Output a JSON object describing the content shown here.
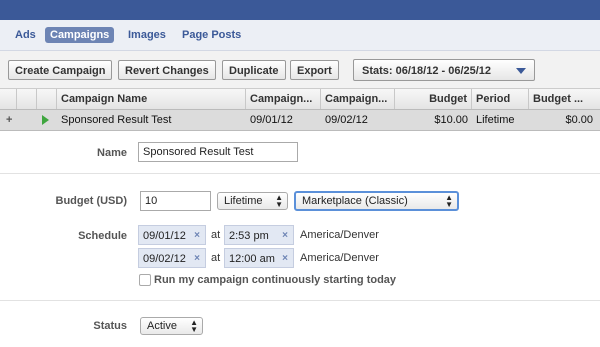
{
  "nav": {
    "tabs": [
      "Ads",
      "Campaigns",
      "Images",
      "Page Posts"
    ],
    "active": "Campaigns"
  },
  "toolbar": {
    "create": "Create Campaign",
    "revert": "Revert Changes",
    "duplicate": "Duplicate",
    "export": "Export",
    "stats": "Stats: 06/18/12 - 06/25/12"
  },
  "table": {
    "headers": [
      "Campaign Name",
      "Campaign...",
      "Campaign...",
      "Budget",
      "Period",
      "Budget ..."
    ],
    "row": {
      "expand": "+",
      "name": "Sponsored Result Test",
      "start": "09/01/12",
      "end": "09/02/12",
      "budget": "$10.00",
      "period": "Lifetime",
      "budget_remaining": "$0.00"
    }
  },
  "form": {
    "name_label": "Name",
    "name_value": "Sponsored Result Test",
    "budget_label": "Budget (USD)",
    "budget_value": "10",
    "budget_type": "Lifetime",
    "pricing": "Marketplace (Classic)",
    "schedule_label": "Schedule",
    "start_date": "09/01/12",
    "start_time": "2:53 pm",
    "end_date": "09/02/12",
    "end_time": "12:00 am",
    "at": "at",
    "timezone": "America/Denver",
    "continuous_label": "Run my campaign continuously starting today",
    "status_label": "Status",
    "status_value": "Active"
  },
  "colors": {
    "brand": "#3b5998",
    "active_tab": "#6d84b4",
    "row_bg": "#dcdcdc",
    "play": "#3fa63f"
  }
}
